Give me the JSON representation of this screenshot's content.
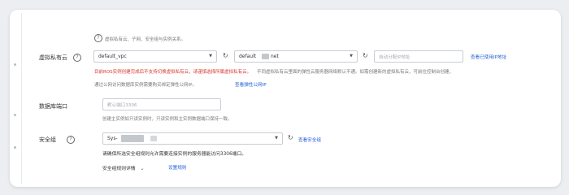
{
  "header_hint": "虚拟私有云、子网、安全组与实例关系。",
  "vpc": {
    "label": "虚拟私有云",
    "vpc_select": "default_vpc",
    "subnet_select_prefix": "default",
    "subnet_select_suffix": "net",
    "ip_placeholder": "自动分配IP地址",
    "view_ip_link": "查看已使用IP地址",
    "error_text": "目前ROS实例创建完成后不支持切换虚拟私有云，请谨慎选择所属虚拟私有云。",
    "error_text_2": "不同虚拟私有云里面的弹性云服务器网络默认不通。如需创建新的虚拟私有云，可前往控制台创建。",
    "public_hint": "通过公网访问数据库实例需要购买绑定弹性公网IP。",
    "public_link": "查看弹性公网IP"
  },
  "port": {
    "label": "数据库端口",
    "placeholder": "默认端口3306",
    "hint": "创建主实例如只读实例时，只读实例和主实例数据端口保持一致。"
  },
  "sg": {
    "label": "安全组",
    "select_value": "Sys-",
    "view_link": "查看安全组",
    "warning": "请确保所选安全组规则允许需要连接实例的服务器能访问3306端口。",
    "rules_label": "安全组规则详情",
    "settings_link": "设置规则"
  }
}
